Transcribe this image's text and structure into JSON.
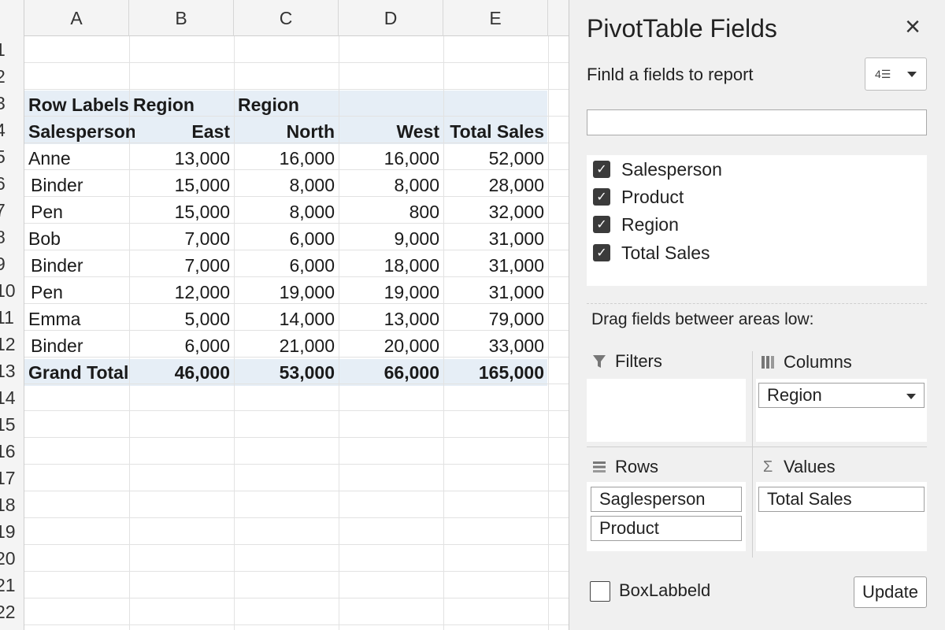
{
  "sheet": {
    "columns": [
      "A",
      "B",
      "C",
      "D",
      "E"
    ],
    "row_numbers": [
      "1",
      "2",
      "3",
      "4",
      "5",
      "6",
      "7",
      "8",
      "9",
      "10",
      "11",
      "12",
      "13",
      "14",
      "15",
      "16",
      "17",
      "18",
      "19",
      "20",
      "21",
      "22"
    ],
    "header_row1": {
      "a": "Row Labels",
      "b": "Region",
      "c": "Region"
    },
    "header_row2": {
      "a": "Salesperson",
      "b": "East",
      "c": "North",
      "d": "West",
      "e": "Total Sales"
    },
    "rows": [
      {
        "label": "Anne",
        "indent": false,
        "east": "13,000",
        "north": "16,000",
        "west": "16,000",
        "total": "52,000"
      },
      {
        "label": "Binder",
        "indent": true,
        "east": "15,000",
        "north": "8,000",
        "west": "8,000",
        "total": "28,000"
      },
      {
        "label": "Pen",
        "indent": true,
        "east": "15,000",
        "north": "8,000",
        "west": "800",
        "total": "32,000"
      },
      {
        "label": "Bob",
        "indent": false,
        "east": "7,000",
        "north": "6,000",
        "west": "9,000",
        "total": "31,000"
      },
      {
        "label": "Binder",
        "indent": true,
        "east": "7,000",
        "north": "6,000",
        "west": "18,000",
        "total": "31,000"
      },
      {
        "label": "Pen",
        "indent": true,
        "east": "12,000",
        "north": "19,000",
        "west": "19,000",
        "total": "31,000"
      },
      {
        "label": "Emma",
        "indent": false,
        "east": "5,000",
        "north": "14,000",
        "west": "13,000",
        "total": "79,000"
      },
      {
        "label": "Binder",
        "indent": true,
        "east": "6,000",
        "north": "21,000",
        "west": "20,000",
        "total": "33,000"
      }
    ],
    "grand_total": {
      "label": "Grand Total",
      "east": "46,000",
      "north": "53,000",
      "west": "66,000",
      "total": "165,000"
    }
  },
  "pane": {
    "title": "PivotTable Fields",
    "close_icon": "×",
    "find_label": "Finld a fields to report",
    "tools_icon": "4☰",
    "search_value": "",
    "fields": [
      {
        "label": "Salesperson",
        "checked": true
      },
      {
        "label": "Product",
        "checked": true
      },
      {
        "label": "Region",
        "checked": true
      },
      {
        "label": "Total Sales",
        "checked": true
      }
    ],
    "drag_label": "Drag fields betweer areas low:",
    "areas": {
      "filters": {
        "title": "Filters",
        "icon": "filter-icon",
        "items": []
      },
      "columns": {
        "title": "Columns",
        "icon": "columns-icon",
        "items": [
          "Region"
        ]
      },
      "rows": {
        "title": "Rows",
        "icon": "rows-icon",
        "items": [
          "Saglesperson",
          "Product"
        ]
      },
      "values": {
        "title": "Values",
        "icon": "sigma-icon",
        "items": [
          "Total Sales"
        ]
      }
    },
    "defer_label": "BoxLabbeld",
    "update_label": "Update"
  },
  "colors": {
    "pivot_band": "#e6eef6",
    "pane_bg": "#f0f0f0",
    "checkbox": "#3b3b3b"
  }
}
